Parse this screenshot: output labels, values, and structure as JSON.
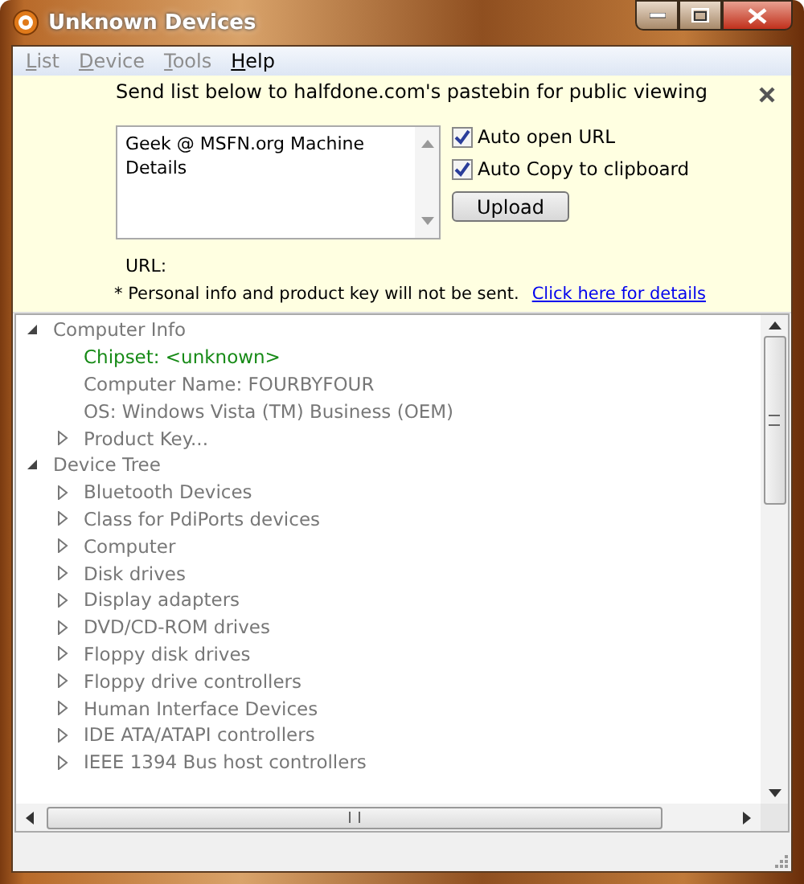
{
  "window": {
    "title": "Unknown Devices"
  },
  "menu": [
    {
      "label": "List",
      "disabled": true
    },
    {
      "label": "Device",
      "disabled": true
    },
    {
      "label": "Tools",
      "disabled": true
    },
    {
      "label": "Help",
      "disabled": false
    }
  ],
  "upload_panel": {
    "heading": "Send list below to halfdone.com's pastebin for public viewing",
    "text_box": {
      "value": "Geek @ MSFN.org Machine Details"
    },
    "options": [
      {
        "label": "Auto open URL",
        "checked": true
      },
      {
        "label": "Auto Copy to clipboard",
        "checked": true
      }
    ],
    "upload_button": "Upload",
    "url_label": "URL:",
    "note": "* Personal info and product key will not be sent.",
    "details_link": "Click here for details"
  },
  "tree": [
    {
      "label": "Computer Info",
      "expanded": true,
      "children": [
        {
          "label": "Chipset: <unknown>",
          "flagged": true
        },
        {
          "label": "Computer Name: FOURBYFOUR",
          "flagged": false
        },
        {
          "label": "OS: Windows Vista (TM) Business  (OEM)",
          "flagged": false
        },
        {
          "label": "Product Key...",
          "expanded": false
        }
      ]
    },
    {
      "label": "Device Tree",
      "expanded": true,
      "children": [
        {
          "label": "Bluetooth Devices",
          "expanded": false
        },
        {
          "label": "Class for PdiPorts devices",
          "expanded": false
        },
        {
          "label": "Computer",
          "expanded": false
        },
        {
          "label": "Disk drives",
          "expanded": false
        },
        {
          "label": "Display adapters",
          "expanded": false
        },
        {
          "label": "DVD/CD-ROM drives",
          "expanded": false
        },
        {
          "label": "Floppy disk drives",
          "expanded": false
        },
        {
          "label": "Floppy drive controllers",
          "expanded": false
        },
        {
          "label": "Human Interface Devices",
          "expanded": false
        },
        {
          "label": "IDE ATA/ATAPI controllers",
          "expanded": false
        },
        {
          "label": "IEEE 1394 Bus host controllers",
          "expanded": false
        }
      ]
    }
  ]
}
